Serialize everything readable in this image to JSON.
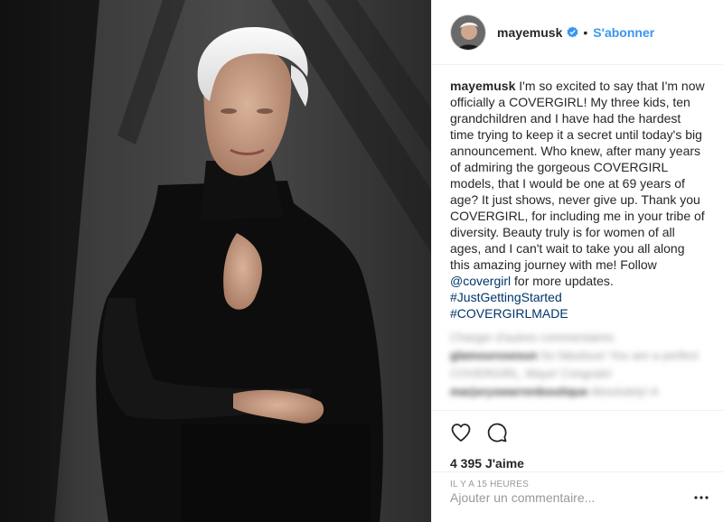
{
  "post": {
    "username": "mayemusk",
    "follow_label": "S'abonner",
    "separator": "•",
    "caption": {
      "username": "mayemusk",
      "text_1": "I'm so excited to say that I'm now officially a COVERGIRL! My three kids, ten grandchildren and I have had the hardest time trying to keep it a secret until today's big announcement. Who knew, after many years of admiring the gorgeous COVERGIRL models, that I would be one at 69 years of age? It just shows, never give up. Thank you COVERGIRL, for including me in your tribe of diversity. Beauty truly is for women of all ages, and I can't wait to take you all along this amazing journey with me! Follow ",
      "mention": "@covergirl",
      "text_2": " for more updates. ",
      "hashtag_1": "#JustGettingStarted",
      "hashtag_2": "#COVERGIRLMADE"
    },
    "blurred_comments": {
      "load_more": "Charger d'autres commentaires",
      "comment_1_user": "glamourosesun",
      "comment_1_text": "So fabulous! You are a perfect COVERGIRL, Maye! Congrats!",
      "comment_2_user": "marjoryswarrenboutique",
      "comment_2_text": "Absolutely! A"
    },
    "likes_count": "4 395",
    "likes_label": "J'aime",
    "timestamp": "IL Y A 15 HEURES",
    "add_comment_placeholder": "Ajouter un commentaire...",
    "colors": {
      "link_blue": "#3897f0",
      "verified_blue": "#3897f0",
      "text": "#262626",
      "muted": "#999999"
    },
    "icons": {
      "like": "heart-icon",
      "comment": "comment-icon",
      "verified": "verified-badge-icon",
      "more": "more-options-icon"
    }
  }
}
